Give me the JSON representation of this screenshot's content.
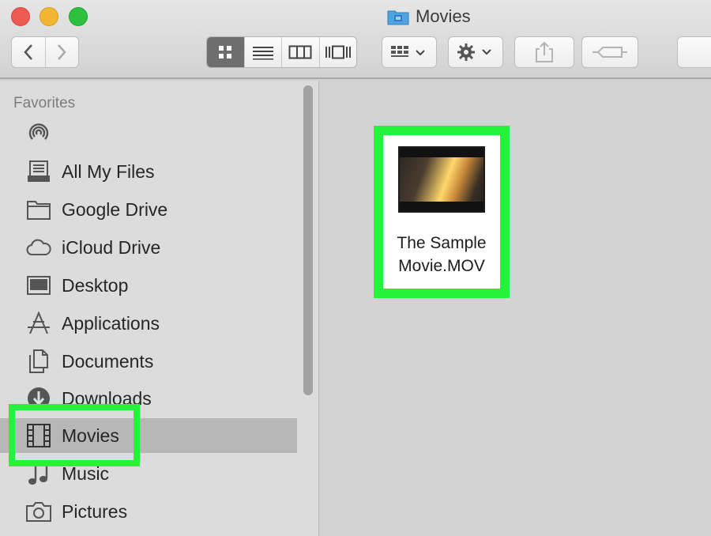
{
  "window": {
    "title": "Movies"
  },
  "toolbar": {
    "back": "back",
    "forward": "forward",
    "views": [
      "icon-view",
      "list-view",
      "column-view",
      "cover-flow-view"
    ],
    "arrange": "arrange",
    "action": "action",
    "share": "share",
    "tags": "tags"
  },
  "sidebar": {
    "heading": "Favorites",
    "items": [
      {
        "label": "",
        "icon": "airdrop-icon"
      },
      {
        "label": "All My Files",
        "icon": "all-files-icon"
      },
      {
        "label": "Google Drive",
        "icon": "folder-icon"
      },
      {
        "label": "iCloud Drive",
        "icon": "cloud-icon"
      },
      {
        "label": "Desktop",
        "icon": "desktop-icon"
      },
      {
        "label": "Applications",
        "icon": "applications-icon"
      },
      {
        "label": "Documents",
        "icon": "documents-icon"
      },
      {
        "label": "Downloads",
        "icon": "downloads-icon"
      },
      {
        "label": "Movies",
        "icon": "film-icon",
        "selected": true
      },
      {
        "label": "Music",
        "icon": "music-icon"
      },
      {
        "label": "Pictures",
        "icon": "camera-icon"
      }
    ]
  },
  "content": {
    "files": [
      {
        "name_line1": "The Sample",
        "name_line2": "Movie.MOV"
      }
    ]
  },
  "colors": {
    "highlight": "#25f23a",
    "selection": "#b7b7b7"
  }
}
